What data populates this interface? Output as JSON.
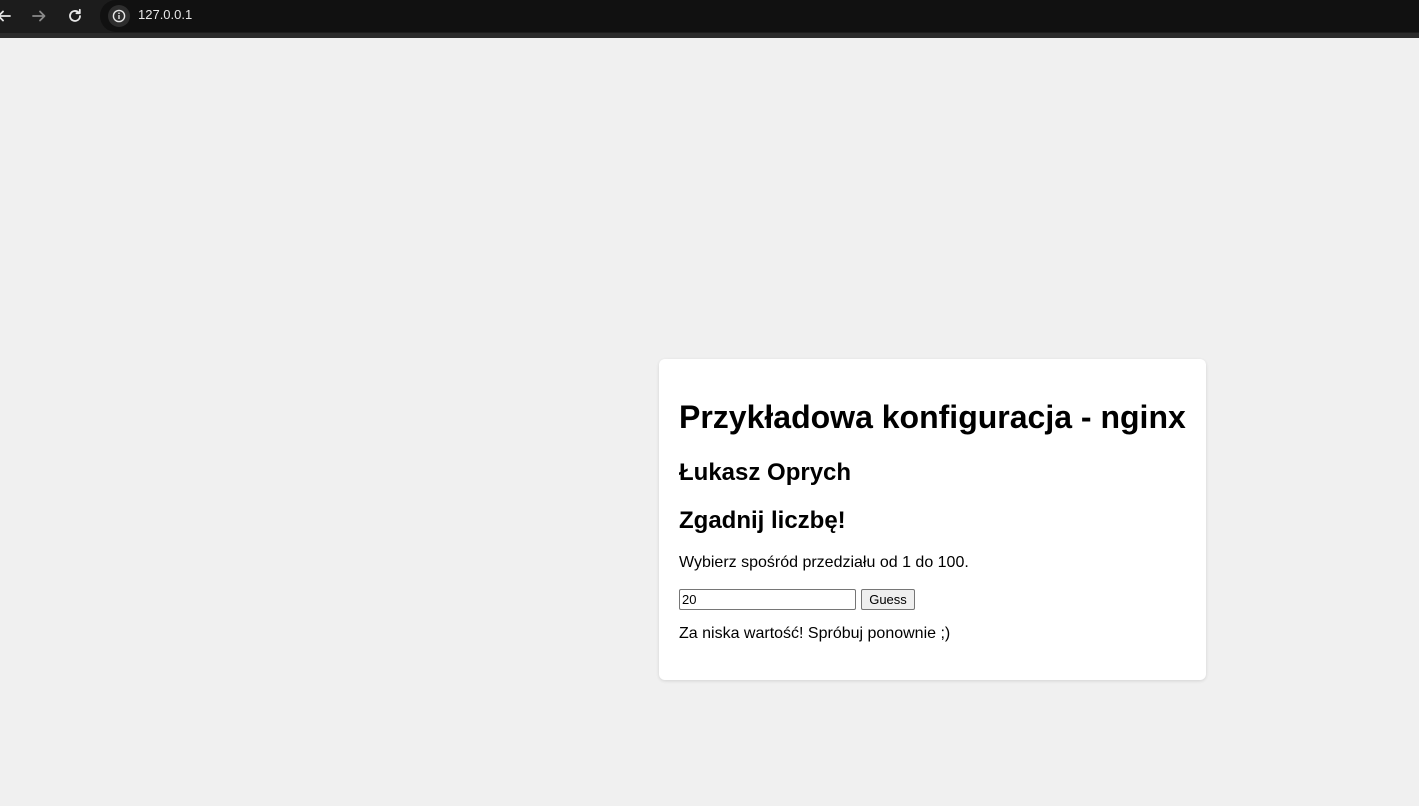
{
  "browser": {
    "url": "127.0.0.1",
    "icons": [
      "back-arrow-icon",
      "forward-arrow-icon",
      "reload-icon",
      "site-info-icon"
    ]
  },
  "page": {
    "title": "Przykładowa konfiguracja - nginx",
    "author": "Łukasz Oprych",
    "game_title": "Zgadnij liczbę!",
    "instruction": "Wybierz spośród przedziału od 1 do 100.",
    "guess_input_value": "20",
    "guess_button_label": "Guess",
    "result_message": "Za niska wartość! Spróbuj ponownie ;)"
  },
  "colors": {
    "page_background": "#f0f0f0",
    "card_background": "#ffffff",
    "toolbar_background": "#1c1c1c"
  }
}
